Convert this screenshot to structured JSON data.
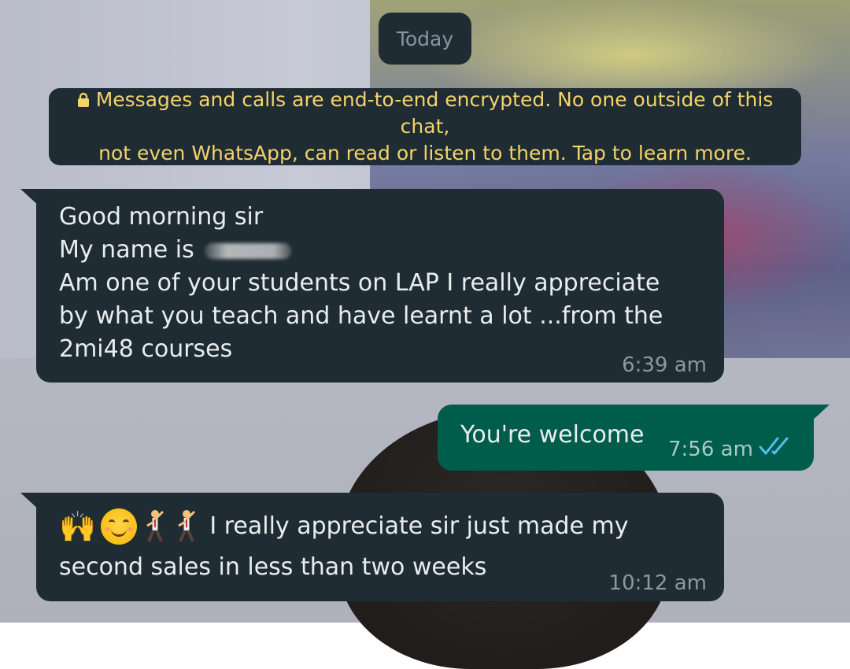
{
  "date_chip": "Today",
  "encryption_notice": {
    "line1": "Messages and calls are end-to-end encrypted. No one outside of this chat,",
    "line2": "not even WhatsApp, can read or listen to them. Tap to learn more.",
    "icon": "lock-icon",
    "color": "#f3d36b"
  },
  "messages": [
    {
      "direction": "incoming",
      "lines": [
        "Good morning sir",
        "My name is",
        "Am one of your students on LAP I really appreciate",
        "by what you teach and have learnt a lot ...from the",
        "2mi48 courses"
      ],
      "name_redacted": true,
      "time": "6:39 am"
    },
    {
      "direction": "outgoing",
      "text": "You're welcome",
      "time": "7:56 am",
      "status": "read",
      "status_icon": "double-check-icon",
      "status_color": "#53bdeb"
    },
    {
      "direction": "incoming",
      "emojis": [
        "raising-hands",
        "smiling-face",
        "man-dancing",
        "man-dancing"
      ],
      "line1": "I really appreciate sir just made my",
      "line2": "second sales in less than two weeks",
      "time": "10:12 am"
    }
  ],
  "colors": {
    "incoming_bubble": "#1f2c33",
    "outgoing_bubble": "#005c4b",
    "text": "#e9edef",
    "timestamp": "#8d999f"
  }
}
